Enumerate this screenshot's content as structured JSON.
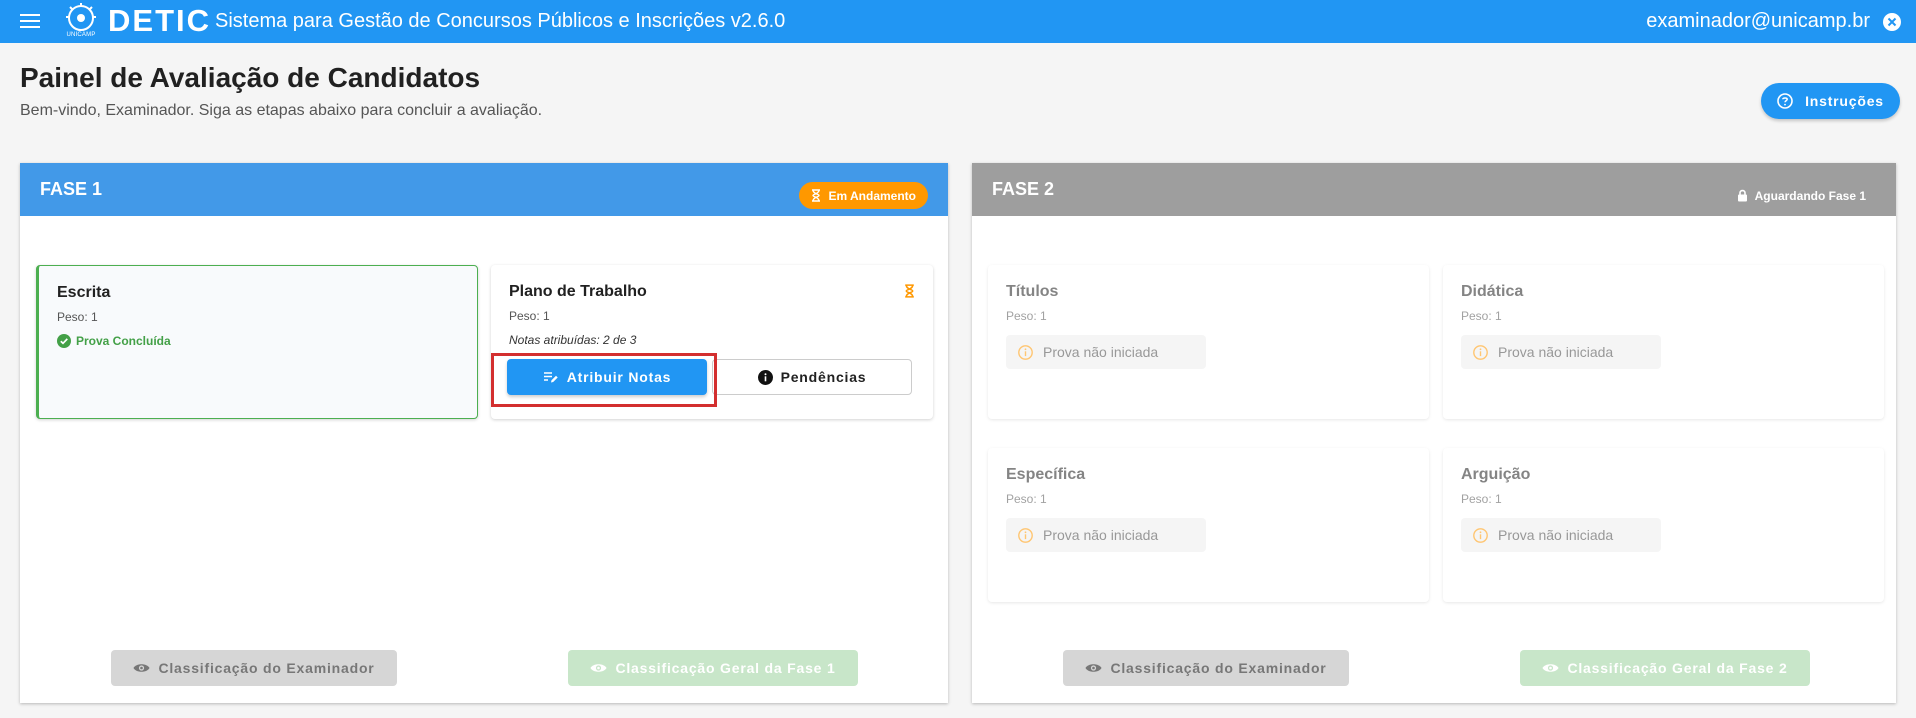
{
  "app": {
    "logo_text": "DETIC",
    "logo_caption": "UNICAMP",
    "title": "Sistema para Gestão de Concursos Públicos e Inscrições v2.6.0",
    "user_email": "examinador@unicamp.br"
  },
  "header": {
    "title": "Painel de Avaliação de Candidatos",
    "subtitle": "Bem-vindo, Examinador. Siga as etapas abaixo para concluir a avaliação.",
    "instructions_label": "Instruções"
  },
  "phase1": {
    "title": "FASE 1",
    "status": "Em Andamento",
    "status_color": "#ff9800",
    "header_color": "#4299e8",
    "cards": [
      {
        "title": "Escrita",
        "weight": "Peso: 1",
        "status": "Prova Concluída"
      },
      {
        "title": "Plano de Trabalho",
        "weight": "Peso: 1",
        "notes": "Notas atribuídas: 2 de 3",
        "assign_label": "Atribuir Notas",
        "pending_label": "Pendências"
      }
    ],
    "footer": {
      "examiner_label": "Classificação do Examinador",
      "general_label": "Classificação Geral da Fase 1"
    }
  },
  "phase2": {
    "title": "FASE 2",
    "status": "Aguardando Fase 1",
    "header_color": "#9e9e9e",
    "cards": [
      {
        "title": "Títulos",
        "weight": "Peso: 1",
        "status": "Prova não iniciada"
      },
      {
        "title": "Didática",
        "weight": "Peso: 1",
        "status": "Prova não iniciada"
      },
      {
        "title": "Específica",
        "weight": "Peso: 1",
        "status": "Prova não iniciada"
      },
      {
        "title": "Arguição",
        "weight": "Peso: 1",
        "status": "Prova não iniciada"
      }
    ],
    "footer": {
      "examiner_label": "Classificação do Examinador",
      "general_label": "Classificação Geral da Fase 2"
    }
  },
  "colors": {
    "primary": "#2196f3",
    "success": "#43a047",
    "warning": "#ff9800",
    "highlight": "#d32f2f"
  }
}
